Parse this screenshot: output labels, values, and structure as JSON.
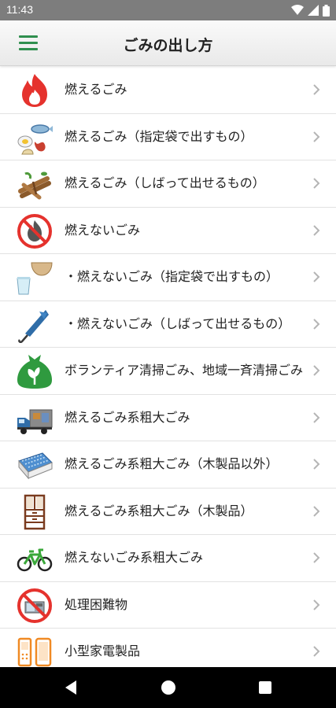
{
  "status_bar": {
    "time": "11:43"
  },
  "app_bar": {
    "title": "ごみの出し方"
  },
  "items": [
    {
      "icon": "fire-icon",
      "label": "燃えるごみ"
    },
    {
      "icon": "kitchen-waste-icon",
      "label": "燃えるごみ（指定袋で出すもの）"
    },
    {
      "icon": "bundled-branches-icon",
      "label": "燃えるごみ（しばって出せるもの）"
    },
    {
      "icon": "no-fire-icon",
      "label": "燃えないごみ"
    },
    {
      "icon": "cup-bowl-icon",
      "label": "・燃えないごみ（指定袋で出すもの）"
    },
    {
      "icon": "umbrella-icon",
      "label": "・燃えないごみ（しばって出せるもの）"
    },
    {
      "icon": "volunteer-bag-icon",
      "label": "ボランティア清掃ごみ、地域一斉清掃ごみ"
    },
    {
      "icon": "truck-icon",
      "label": "燃えるごみ系粗大ごみ"
    },
    {
      "icon": "futon-icon",
      "label": "燃えるごみ系粗大ごみ（木製品以外）"
    },
    {
      "icon": "cabinet-icon",
      "label": "燃えるごみ系粗大ごみ（木製品）"
    },
    {
      "icon": "bicycle-icon",
      "label": "燃えないごみ系粗大ごみ"
    },
    {
      "icon": "prohibited-items-icon",
      "label": "処理困難物"
    },
    {
      "icon": "phone-icon",
      "label": "小型家電製品"
    }
  ],
  "colors": {
    "accent": "#2f8f4e",
    "status_bar": "#7d7d7d",
    "nav_bar": "#000000"
  }
}
